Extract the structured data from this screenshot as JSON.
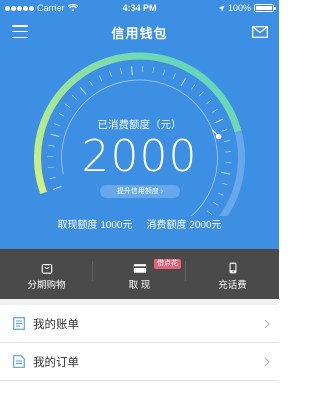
{
  "status_bar": {
    "carrier": "Carrier",
    "time": "4:34 PM",
    "battery": "100%"
  },
  "header": {
    "title": "信用钱包",
    "left_icon": "menu-icon",
    "right_icon": "mail-icon"
  },
  "gauge": {
    "label": "已消费额度（元）",
    "amount": "2000",
    "raise_button": "提升信用额度 ›",
    "fill_fraction": 0.66,
    "colors": {
      "start": "#d8f27a",
      "end": "#4fd0c5"
    }
  },
  "limits": {
    "withdrawn": "取现额度  1000元",
    "consumed": "消费额度  2000元"
  },
  "actions": [
    {
      "label": "分期购物",
      "icon": "shopping-bag-icon"
    },
    {
      "label": "取 现",
      "icon": "card-icon",
      "badge": "借点花"
    },
    {
      "label": "充话费",
      "icon": "phone-icon"
    }
  ],
  "menu": [
    {
      "label": "我的账单",
      "icon": "bill-icon"
    },
    {
      "label": "我的订单",
      "icon": "order-icon"
    }
  ],
  "theme": {
    "primary": "#3d8fe4",
    "dark_bar": "#4a4a4a",
    "accent_badge": "#e8627a"
  }
}
